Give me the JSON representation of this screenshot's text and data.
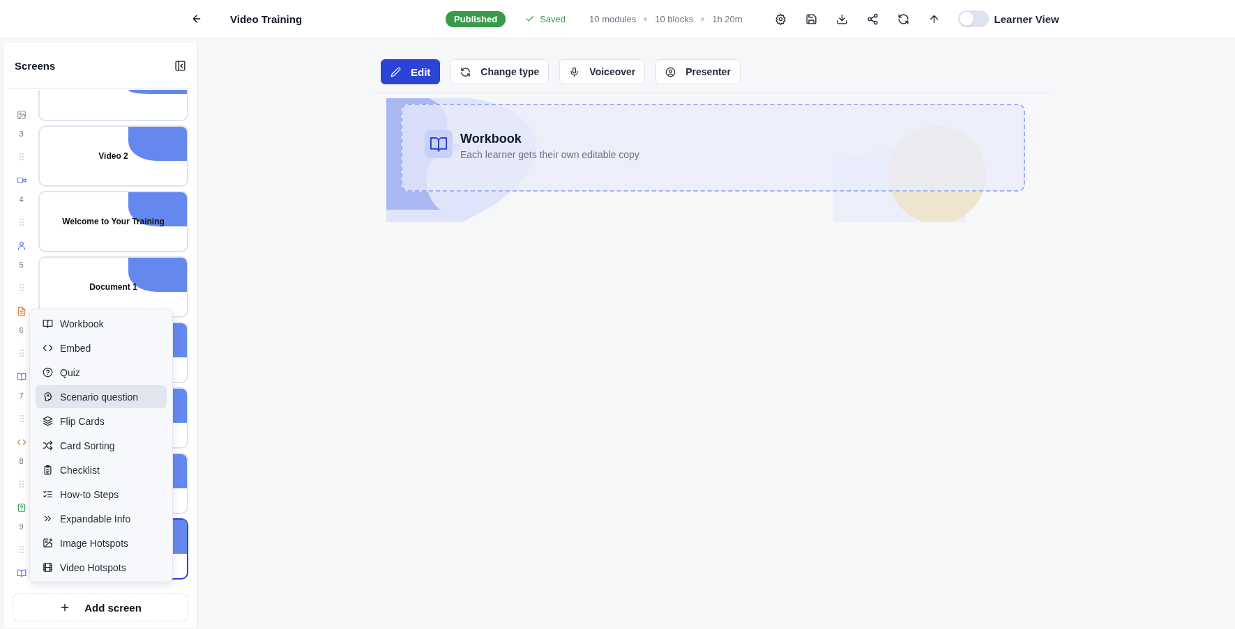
{
  "header": {
    "title": "Video Training",
    "status": "Published",
    "save_state": "Saved",
    "stats": [
      "10 modules",
      "10 blocks",
      "1h 20m"
    ],
    "learner_view": {
      "label": "Learner View",
      "on": false
    }
  },
  "sidebar": {
    "title": "Screens",
    "screens": [
      {
        "kind": "image",
        "selected": false
      },
      {
        "number": "3",
        "title": "Video 2",
        "kind": "video",
        "selected": false
      },
      {
        "number": "4",
        "title": "Welcome to Your Training",
        "kind": "person",
        "selected": false
      },
      {
        "number": "5",
        "title": "Document 1",
        "kind": "document",
        "selected": false
      },
      {
        "number": "6",
        "kind": "book",
        "selected": false
      },
      {
        "number": "7",
        "kind": "code",
        "selected": false
      },
      {
        "number": "8",
        "kind": "quiz",
        "selected": false
      },
      {
        "number": "9",
        "kind": "book",
        "selected": true
      }
    ],
    "add_menu": [
      {
        "label": "Workbook",
        "kind": "book",
        "highlighted": false
      },
      {
        "label": "Embed",
        "kind": "code",
        "highlighted": false
      },
      {
        "label": "Quiz",
        "kind": "help",
        "highlighted": false
      },
      {
        "label": "Scenario question",
        "kind": "head",
        "highlighted": true
      },
      {
        "label": "Flip Cards",
        "kind": "layers",
        "highlighted": false
      },
      {
        "label": "Card Sorting",
        "kind": "shuffle",
        "highlighted": false
      },
      {
        "label": "Checklist",
        "kind": "clipboard",
        "highlighted": false
      },
      {
        "label": "How-to Steps",
        "kind": "listchecks",
        "highlighted": false
      },
      {
        "label": "Expandable Info",
        "kind": "chevrons",
        "highlighted": false
      },
      {
        "label": "Image Hotspots",
        "kind": "imageplus",
        "highlighted": false
      },
      {
        "label": "Video Hotspots",
        "kind": "film",
        "highlighted": false
      }
    ],
    "add_button": "Add screen"
  },
  "toolbar": [
    {
      "label": "Edit",
      "kind": "pencil",
      "primary": true
    },
    {
      "label": "Change type",
      "kind": "refresh",
      "primary": false
    },
    {
      "label": "Voiceover",
      "kind": "mic",
      "primary": false
    },
    {
      "label": "Presenter",
      "kind": "usercircle",
      "primary": false
    }
  ],
  "block": {
    "title": "Workbook",
    "subtitle": "Each learner gets their own editable copy"
  }
}
